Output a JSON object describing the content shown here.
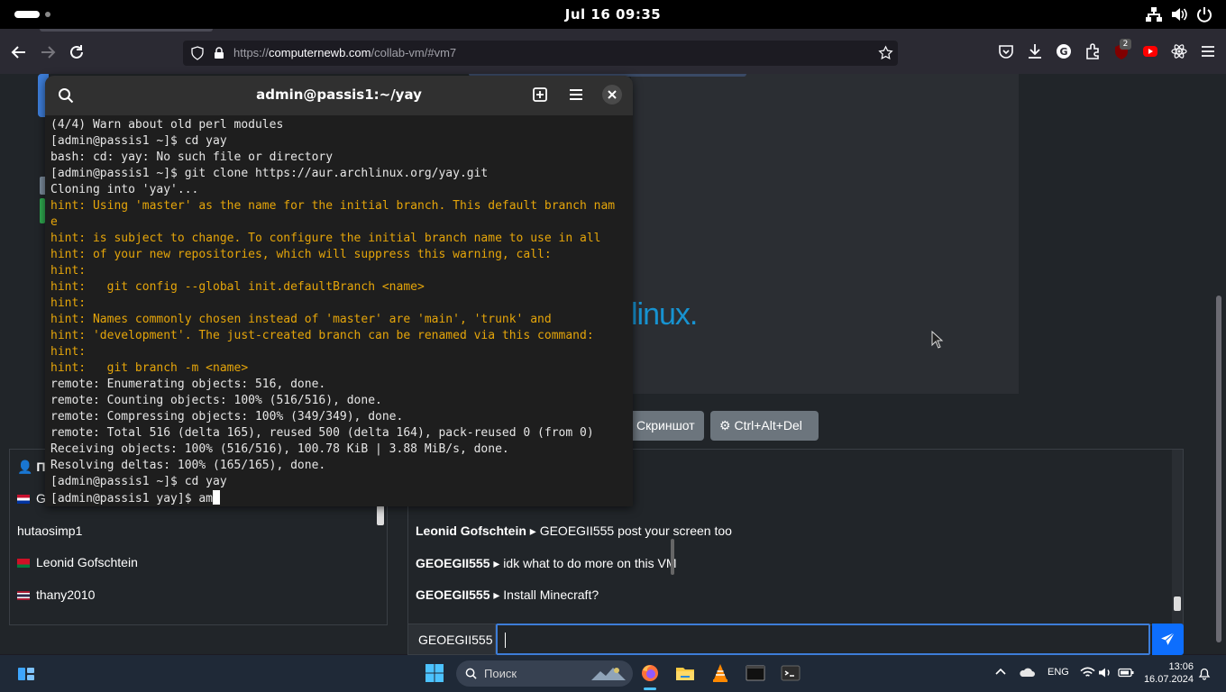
{
  "topbar": {
    "clock": "Jul 16  09:35"
  },
  "browser": {
    "url_prefix": "https://",
    "url_domain": "computernewb.com",
    "url_path": "/collab-vm/#vm7",
    "ext_badge": "2"
  },
  "vm": {
    "logo_text": "linux.",
    "buttons": {
      "screenshot": "Скриншот",
      "ctrlaltdel": "Ctrl+Alt+Del"
    }
  },
  "users": {
    "header": "По",
    "list": [
      {
        "name": "G.",
        "flag_colors": [
          "#c8102e",
          "#ffffff",
          "#0033a0"
        ]
      },
      {
        "name": "hutaosimp1",
        "flag_colors": []
      },
      {
        "name": "Leonid Gofschtein",
        "flag_colors": [
          "#ce1126",
          "#ffffff",
          "#007a3d"
        ]
      },
      {
        "name": "thany2010",
        "flag_colors": [
          "#a51931",
          "#f4f5f8",
          "#2d2a4a"
        ]
      }
    ]
  },
  "chat": {
    "messages": [
      {
        "user": "Leonid Gofschtein",
        "text": "GEOEGII555 post your screen too"
      },
      {
        "user": "GEOEGII555",
        "text": "idk what to do more on this VM"
      },
      {
        "user": "GEOEGII555",
        "text": "Install Minecraft?"
      }
    ],
    "nickname": "GEOEGII555",
    "input_value": ""
  },
  "terminal": {
    "title": "admin@passis1:~/yay",
    "lines": [
      {
        "t": "(4/4) Warn about old perl modules",
        "c": "n"
      },
      {
        "t": "[admin@passis1 ~]$ cd yay",
        "c": "n"
      },
      {
        "t": "bash: cd: yay: No such file or directory",
        "c": "n"
      },
      {
        "t": "[admin@passis1 ~]$ git clone https://aur.archlinux.org/yay.git",
        "c": "n"
      },
      {
        "t": "Cloning into 'yay'...",
        "c": "n"
      },
      {
        "t": "hint: Using 'master' as the name for the initial branch. This default branch nam",
        "c": "h"
      },
      {
        "t": "e",
        "c": "h"
      },
      {
        "t": "hint: is subject to change. To configure the initial branch name to use in all",
        "c": "h"
      },
      {
        "t": "hint: of your new repositories, which will suppress this warning, call:",
        "c": "h"
      },
      {
        "t": "hint:",
        "c": "h"
      },
      {
        "t": "hint:   git config --global init.defaultBranch <name>",
        "c": "h"
      },
      {
        "t": "hint:",
        "c": "h"
      },
      {
        "t": "hint: Names commonly chosen instead of 'master' are 'main', 'trunk' and",
        "c": "h"
      },
      {
        "t": "hint: 'development'. The just-created branch can be renamed via this command:",
        "c": "h"
      },
      {
        "t": "hint:",
        "c": "h"
      },
      {
        "t": "hint:   git branch -m <name>",
        "c": "h"
      },
      {
        "t": "remote: Enumerating objects: 516, done.",
        "c": "n"
      },
      {
        "t": "remote: Counting objects: 100% (516/516), done.",
        "c": "n"
      },
      {
        "t": "remote: Compressing objects: 100% (349/349), done.",
        "c": "n"
      },
      {
        "t": "remote: Total 516 (delta 165), reused 500 (delta 164), pack-reused 0 (from 0)",
        "c": "n"
      },
      {
        "t": "Receiving objects: 100% (516/516), 100.78 KiB | 3.88 MiB/s, done.",
        "c": "n"
      },
      {
        "t": "Resolving deltas: 100% (165/165), done.",
        "c": "n"
      },
      {
        "t": "[admin@passis1 ~]$ cd yay",
        "c": "n"
      },
      {
        "t": "[admin@passis1 yay]$ am",
        "c": "n",
        "cursor": true
      }
    ]
  },
  "taskbar": {
    "search_placeholder": "Поиск",
    "lang": "ENG",
    "time": "13:06",
    "date": "16.07.2024"
  },
  "colors": {
    "hint": "#e5a50a",
    "accent": "#0d6efd",
    "arch_blue": "#1793d1"
  }
}
